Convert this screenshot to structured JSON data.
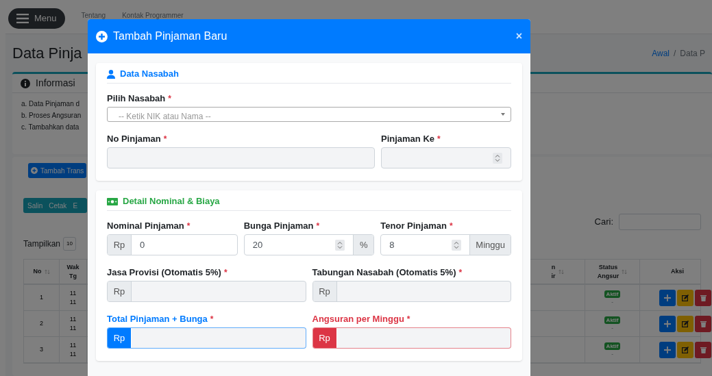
{
  "navbar": {
    "menu_button": "Menu",
    "links": [
      "Tentang",
      "Kontak Programmer"
    ]
  },
  "page_title": "Data Pinja",
  "breadcrumb": [
    {
      "label": "Awal",
      "link": true
    },
    {
      "label": "/",
      "link": false
    },
    {
      "label": "Data P",
      "link": false
    }
  ],
  "info_card": {
    "title": "Informasi",
    "items": [
      "a. Data Pinjaman d",
      "b. Proses Angsuran",
      "c. Tambahkan data"
    ]
  },
  "data_card": {
    "add_button": "Tambah Trans",
    "export_buttons": [
      "Salin",
      "Cetak",
      "E"
    ],
    "length_label": "Tampilkan",
    "length_value": "10",
    "search_label": "Cari:",
    "columns": [
      {
        "lines": [
          "No"
        ],
        "sortable": true
      },
      {
        "lines": [
          "Wak",
          "Tg"
        ],
        "sortable": false
      },
      {
        "lines": [
          "n",
          "ir"
        ],
        "sortable": true
      },
      {
        "lines": [
          "Status",
          "Angsur"
        ],
        "sortable": true
      },
      {
        "lines": [
          "Aksi"
        ],
        "sortable": false
      }
    ],
    "rows": [
      {
        "no": "1",
        "date": [
          "11",
          "11"
        ],
        "status": "Aktif",
        "note": "-"
      },
      {
        "no": "2",
        "date": [
          "11",
          "11"
        ],
        "status": "Aktif",
        "note": "-"
      },
      {
        "no": "3",
        "date": [
          "11",
          "11"
        ],
        "status": "Aktif",
        "note": "-"
      }
    ]
  },
  "modal": {
    "title": "Tambah Pinjaman Baru",
    "close": "×",
    "sections": [
      {
        "title": "Data Nasabah",
        "color": "#007bff",
        "rows": [
          {
            "fields": [
              {
                "kind": "select",
                "label": "Pilih Nasabah",
                "mark": "*",
                "placeholder": "-- Ketik NIK atau Nama --"
              }
            ]
          },
          {
            "fields": [
              {
                "kind": "input",
                "label": "No Pinjaman",
                "mark": "*",
                "readonly": true,
                "spinner": false
              },
              {
                "kind": "input",
                "label": "Pinjaman Ke",
                "mark": "*",
                "readonly": true,
                "spinner": true
              }
            ]
          }
        ]
      },
      {
        "title": "Detail Nominal & Biaya",
        "color": "#28a745",
        "rows": [
          {
            "fields": [
              {
                "kind": "input",
                "label": "Nominal Pinjaman",
                "mark": "*",
                "prefix": "Rp",
                "value": "0",
                "readonly": false,
                "spinner": false
              },
              {
                "kind": "input",
                "label": "Bunga Pinjaman",
                "mark": "*",
                "value": "20",
                "suffix": "%",
                "readonly": false,
                "spinner": true
              },
              {
                "kind": "input",
                "label": "Tenor Pinjaman",
                "mark": "*",
                "value": "8",
                "suffix": "Minggu",
                "readonly": false,
                "spinner": true
              }
            ]
          },
          {
            "fields": [
              {
                "kind": "input",
                "label": "Jasa Provisi (Otomatis 5%)",
                "mark": "*",
                "prefix": "Rp",
                "readonly": true,
                "spinner": false
              },
              {
                "kind": "input",
                "label": "Tabungan Nasabah (Otomatis 5%)",
                "mark": "*",
                "prefix": "Rp",
                "readonly": true,
                "spinner": false
              }
            ]
          },
          {
            "fields": [
              {
                "kind": "input",
                "label": "Total Pinjaman + Bunga",
                "mark": "*",
                "prefix": "Rp",
                "readonly": true,
                "spinner": false,
                "color": "#007bff"
              },
              {
                "kind": "input",
                "label": "Angsuran per Minggu",
                "mark": "*",
                "prefix": "Rp",
                "readonly": true,
                "spinner": false,
                "color": "#dc3545"
              }
            ]
          }
        ]
      }
    ]
  }
}
